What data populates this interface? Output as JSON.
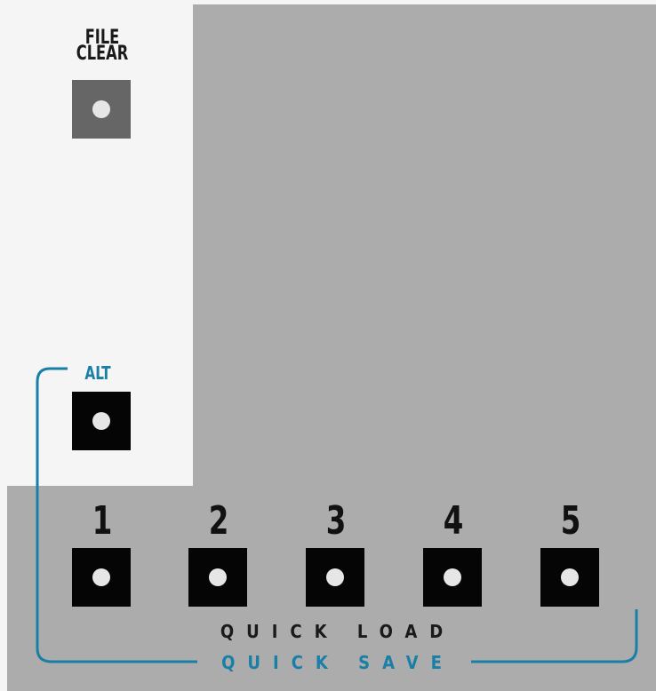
{
  "panel": {
    "file_clear": {
      "line1": "FILE",
      "line2": "CLEAR"
    },
    "alt_label": "ALT",
    "slots": [
      "1",
      "2",
      "3",
      "4",
      "5"
    ],
    "quick_load_label": "QUICK LOAD",
    "quick_save_label": "QUICK SAVE"
  },
  "colors": {
    "panel_bg": "#f5f5f5",
    "gray_region": "#acacac",
    "accent_blue": "#1a7fa6",
    "button_black": "#050505",
    "button_gray": "#666666"
  }
}
